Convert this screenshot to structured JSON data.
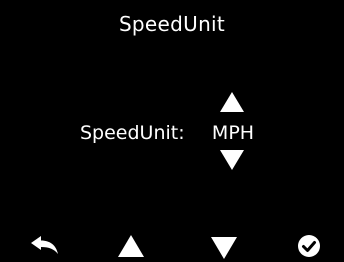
{
  "screen": {
    "title": "SpeedUnit"
  },
  "setting": {
    "label": "SpeedUnit:",
    "value": "MPH"
  },
  "icons": {
    "value_up": "triangle-up-icon",
    "value_down": "triangle-down-icon",
    "back": "back-arrow-icon",
    "nav_up": "triangle-up-icon",
    "nav_down": "triangle-down-icon",
    "confirm": "check-circle-icon"
  },
  "colors": {
    "background": "#000000",
    "foreground": "#ffffff"
  }
}
